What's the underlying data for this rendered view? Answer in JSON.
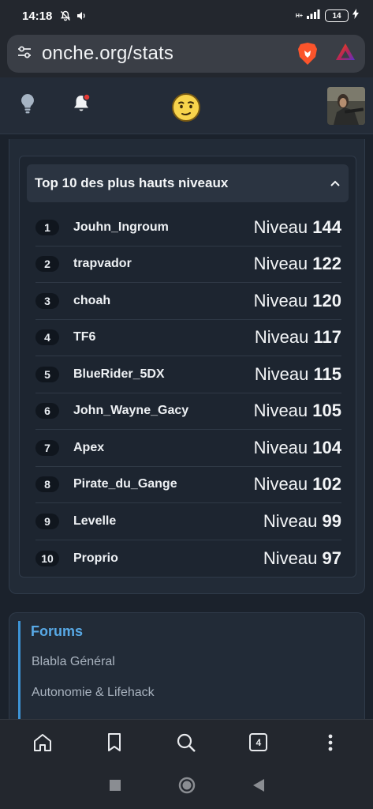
{
  "status_bar": {
    "time": "14:18",
    "battery": "14",
    "network": "H+"
  },
  "browser": {
    "url": "onche.org/stats",
    "open_tabs": "4"
  },
  "ranking": {
    "title": "Top 10 des plus hauts niveaux",
    "level_label": "Niveau",
    "rows": [
      {
        "rank": "1",
        "name": "Jouhn_Ingroum",
        "level": "144"
      },
      {
        "rank": "2",
        "name": "trapvador",
        "level": "122"
      },
      {
        "rank": "3",
        "name": "choah",
        "level": "120"
      },
      {
        "rank": "4",
        "name": "TF6",
        "level": "117"
      },
      {
        "rank": "5",
        "name": "BlueRider_5DX",
        "level": "115"
      },
      {
        "rank": "6",
        "name": "John_Wayne_Gacy",
        "level": "105"
      },
      {
        "rank": "7",
        "name": "Apex",
        "level": "104"
      },
      {
        "rank": "8",
        "name": "Pirate_du_Gange",
        "level": "102"
      },
      {
        "rank": "9",
        "name": "Levelle",
        "level": "99"
      },
      {
        "rank": "10",
        "name": "Proprio",
        "level": "97"
      }
    ]
  },
  "forums": {
    "title": "Forums",
    "links": [
      "Blabla Général",
      "Autonomie & Lifehack"
    ]
  },
  "icons": {
    "header": [
      "lightbulb-icon",
      "bell-icon",
      "smiley-icon"
    ],
    "bottom_bar": [
      "home-icon",
      "bookmark-icon",
      "search-icon",
      "tabs-icon",
      "menu-icon"
    ]
  },
  "colors": {
    "accent": "#58a9e6",
    "background": "#1b222c",
    "notification": "#e53935"
  }
}
